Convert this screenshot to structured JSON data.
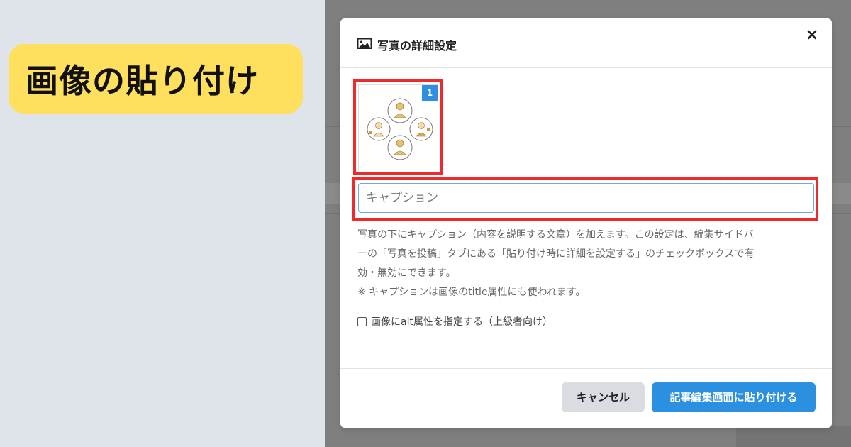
{
  "left_panel": {
    "title": "画像の貼り付け"
  },
  "modal": {
    "header": {
      "icon": "image-icon",
      "title": "写真の詳細設定",
      "close_glyph": "×"
    },
    "thumbnail": {
      "badge": "1"
    },
    "caption": {
      "placeholder": "キャプション",
      "value": ""
    },
    "help_lines": [
      "写真の下にキャプション（内容を説明する文章）を加えます。この設定は、編集サイドバ",
      "ーの「写真を投稿」タブにある「貼り付け時に詳細を設定する」のチェックボックスで有",
      "効・無効にできます。",
      "※ キャプションは画像のtitle属性にも使われます。"
    ],
    "alt_option": {
      "label": "画像にalt属性を指定する（上級者向け）",
      "checked": false
    },
    "footer": {
      "cancel_label": "キャンセル",
      "paste_label": "記事編集画面に貼り付ける"
    }
  },
  "colors": {
    "highlight_border": "#ee2b2b",
    "primary": "#2b90e0",
    "title_pill": "#ffdf5e",
    "left_background": "#dfe4ea",
    "overlay": "#7f7f7f"
  }
}
